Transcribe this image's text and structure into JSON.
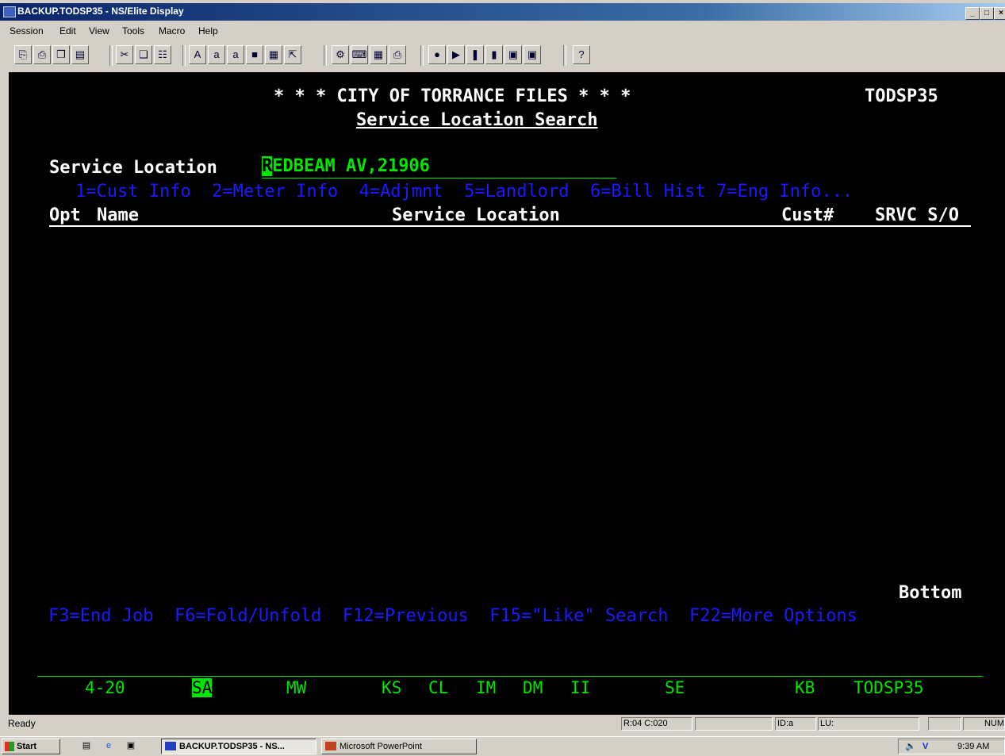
{
  "window": {
    "title": "BACKUP.TODSP35 - NS/Elite Display"
  },
  "menu": [
    "Session",
    "Edit",
    "View",
    "Tools",
    "Macro",
    "Help"
  ],
  "screen": {
    "header": "* * * CITY OF TORRANCE FILES * * *",
    "program_id": "TODSP35",
    "subtitle": "Service Location Search",
    "field_label": "Service Location",
    "field_cursor_char": "R",
    "field_value": "EDBEAM AV,21906",
    "options_line": "1=Cust Info  2=Meter Info  4=Adjmnt  5=Landlord  6=Bill Hist 7=Eng Info...",
    "col_opt": "Opt",
    "col_name": "Name",
    "col_service_location": "Service Location",
    "col_cust": "Cust#",
    "col_srvc": "SRVC S/O",
    "bottom": "Bottom",
    "fkeys": "F3=End Job  F6=Fold/Unfold  F12=Previous  F15=\"Like\" Search  F22=More Options"
  },
  "indicator_line": {
    "items": [
      "4-20",
      "SA",
      "MW",
      "KS",
      "CL",
      "IM",
      "DM",
      "II",
      "SE",
      "KB",
      "TODSP35"
    ]
  },
  "statusbar": {
    "status": "Ready",
    "cursor_pos": "R:04 C:020",
    "id": "ID:a",
    "lu": "LU:",
    "num": "NUM"
  },
  "taskbar": {
    "start": "Start",
    "tasks": [
      "BACKUP.TODSP35 - NS...",
      "Microsoft PowerPoint"
    ],
    "clock": "9:39 AM"
  }
}
